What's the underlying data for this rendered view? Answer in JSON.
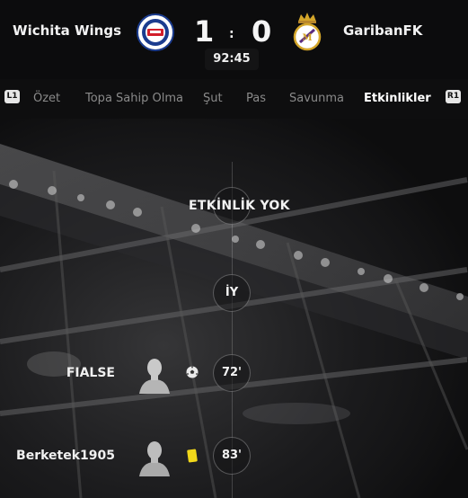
{
  "header": {
    "home_team": "Wichita Wings",
    "away_team": "GaribanFK",
    "score_home": "1",
    "score_separator": ":",
    "score_away": "0",
    "clock": "92:45"
  },
  "tabs": {
    "left_bumper": "L1",
    "right_bumper": "R1",
    "items": [
      {
        "label": "Özet"
      },
      {
        "label": "Topa Sahip Olma"
      },
      {
        "label": "Şut"
      },
      {
        "label": "Pas"
      },
      {
        "label": "Savunma"
      },
      {
        "label": "Etkinlikler"
      }
    ],
    "active": "Etkinlikler"
  },
  "timeline": {
    "no_events": "ETKİNLİK YOK",
    "half_marker": "İY",
    "events": [
      {
        "player": "FIALSE",
        "minute": "72'",
        "type": "goal",
        "icon": "soccer-ball-icon"
      },
      {
        "player": "Berketek1905",
        "minute": "83'",
        "type": "yellow-card",
        "icon": "yellow-card-icon"
      }
    ]
  },
  "colors": {
    "background": "#0d0d0e",
    "active_tab": "#ffffff",
    "inactive_tab": "#8a8a8a",
    "yellow_card": "#f2d81a"
  }
}
